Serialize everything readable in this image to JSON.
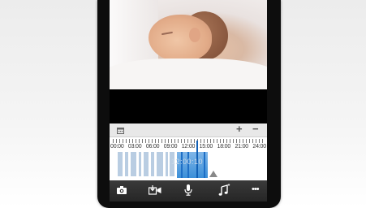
{
  "timeline": {
    "hours": [
      "00:00",
      "03:00",
      "06:00",
      "09:00",
      "12:00",
      "15:00",
      "18:00",
      "21:00",
      "24:00"
    ],
    "zoom_in": "+",
    "zoom_out": "−",
    "current_time": "12:00:10"
  },
  "icons": {
    "calendar": "calendar-icon",
    "snapshot": "camera-icon",
    "record": "record-icon",
    "talk": "microphone-icon",
    "lullaby": "music-icon",
    "more": "more-icon"
  },
  "colors": {
    "accent": "#3b8fd8",
    "toolbar": "#2e2e2e",
    "timeline_bg": "#ffffff"
  }
}
